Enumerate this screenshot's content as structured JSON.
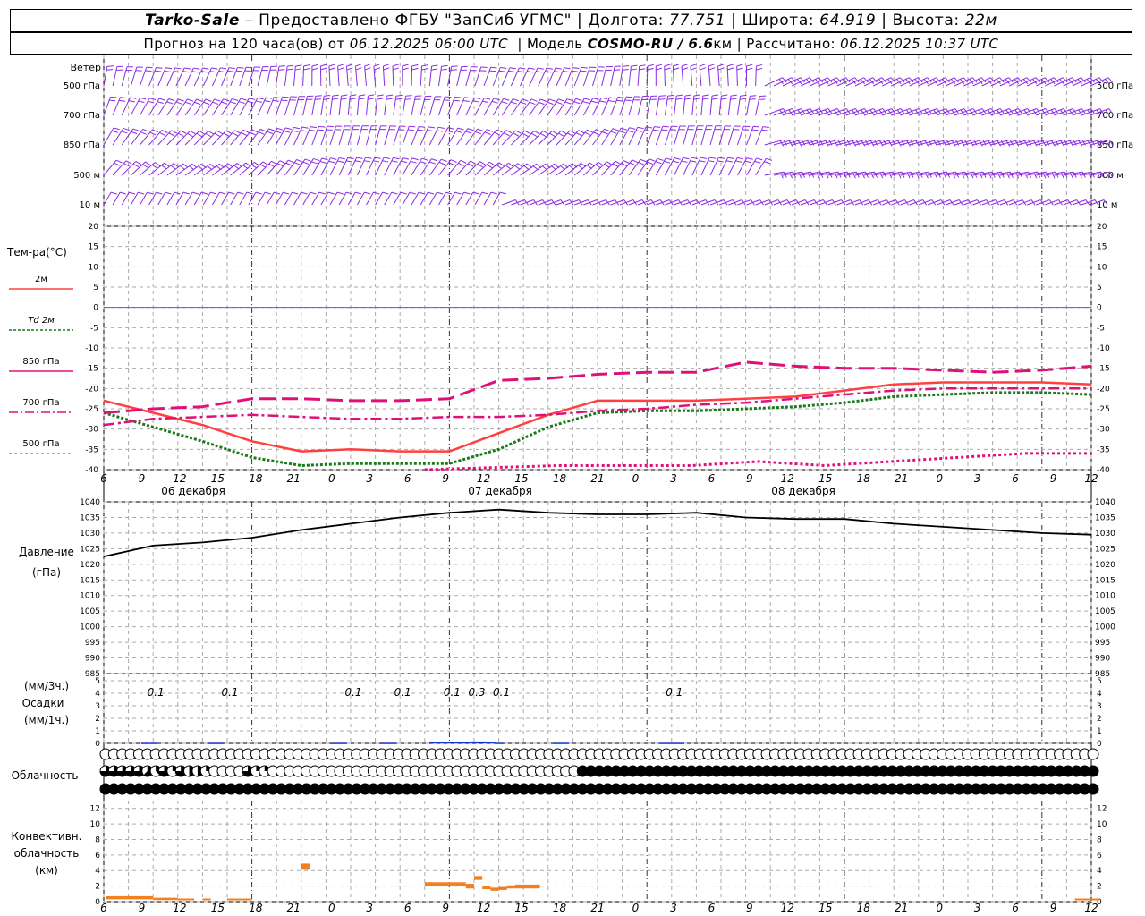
{
  "header": {
    "station": "Tarko-Sale",
    "dash": " – Предоставлено ФГБУ \"ЗапСиб УГМС\" | Долгота: ",
    "longitude": "77.751",
    "lat_label": " | Широта: ",
    "latitude": "64.919",
    "alt_label": " | Высота: ",
    "altitude": "22м",
    "forecast_label": "Прогноз на 120 часа(ов) от ",
    "forecast_start": "06.12.2025 06:00 UTC",
    "model_label": "  | Модель ",
    "model": "COSMO-RU / 6.6",
    "model_unit": "км",
    "calc_label": " | Рассчитано: ",
    "calc_time": "06.12.2025 10:37 UTC"
  },
  "labels": {
    "wind": "Ветер",
    "levels": [
      "500 гПа",
      "700 гПа",
      "850 гПа",
      "500 м",
      "10  м"
    ],
    "temp_title": "Тем-ра(°C)",
    "legend": [
      {
        "text": "2м",
        "color": "#ff4040",
        "dash": ""
      },
      {
        "text": "Td  2м",
        "color": "#1a7a1a",
        "dash": "3,2"
      },
      {
        "text": "850 гПа",
        "color": "#e0107a",
        "dash": ""
      },
      {
        "text": "700 гПа",
        "color": "#e0107a",
        "dash": "10,3,2,3"
      },
      {
        "text": "500 гПа",
        "color": "#e0107a",
        "dash": "3,3"
      }
    ],
    "pressure_title": "Давление",
    "pressure_unit": "(гПа)",
    "precip_unit1": "(мм/3ч.)",
    "precip_title": "Осадки",
    "precip_unit2": "(мм/1ч.)",
    "cloud_title": "Облачность",
    "conv_title1": "Конвективн.",
    "conv_title2": "облачность",
    "conv_unit": "(км)",
    "dates": [
      "06 декабря",
      "07 декабря",
      "08 декабря"
    ]
  },
  "colors": {
    "wind": "#8a2be2",
    "t2m": "#ff4040",
    "td2m": "#1a7a1a",
    "t850": "#e0107a",
    "zero": "#4060ff",
    "precip": "#1030d0",
    "conv": "#f08020"
  },
  "chart_data": [
    {
      "type": "line",
      "title": "Тем-ра(°C)",
      "x_ticks": [
        "6",
        "9",
        "12",
        "15",
        "18",
        "21",
        "0",
        "3",
        "6",
        "9",
        "12",
        "15",
        "18",
        "21",
        "0",
        "3",
        "6",
        "9",
        "12",
        "15",
        "18",
        "21",
        "0",
        "3",
        "6",
        "9",
        "12"
      ],
      "ylim": [
        -40,
        20
      ],
      "yticks": [
        -40,
        -35,
        -30,
        -25,
        -20,
        -15,
        -10,
        -5,
        0,
        5,
        10,
        15,
        20
      ],
      "x_hours": [
        0,
        6,
        12,
        18,
        24,
        30,
        36,
        42,
        48,
        54,
        60,
        66,
        72,
        78,
        84,
        90,
        96,
        102,
        108,
        114,
        120
      ],
      "series": [
        {
          "name": "2м",
          "values": [
            -23,
            -26,
            -29,
            -33,
            -35.5,
            -35,
            -35.5,
            -35.5,
            -31,
            -26.5,
            -23,
            -23,
            -23,
            -22.5,
            -22,
            -20.5,
            -19,
            -18.5,
            -18.5,
            -18.5,
            -19
          ]
        },
        {
          "name": "Td  2м",
          "values": [
            -26,
            -29.5,
            -33,
            -37,
            -39,
            -38.5,
            -38.5,
            -38.5,
            -35,
            -29.5,
            -26,
            -25.5,
            -25.5,
            -25,
            -24.5,
            -23.5,
            -22,
            -21.5,
            -21,
            -21,
            -21.5
          ]
        },
        {
          "name": "850 гПа",
          "values": [
            -26,
            -25,
            -24.5,
            -22.5,
            -22.5,
            -23,
            -23,
            -22.5,
            -18,
            -17.5,
            -16.5,
            -16,
            -16,
            -13.5,
            -14.5,
            -15,
            -15,
            -15.5,
            -16,
            -15.5,
            -14.5
          ]
        },
        {
          "name": "700 гПа",
          "values": [
            -29,
            -27.5,
            -27,
            -26.5,
            -27,
            -27.5,
            -27.5,
            -27,
            -27,
            -26.5,
            -25.5,
            -25,
            -24,
            -23.5,
            -22.5,
            -21.5,
            -20.5,
            -20,
            -20,
            -20,
            -20
          ]
        },
        {
          "name": "500 гПа",
          "x_start": 39,
          "values": [
            -40,
            -39.5,
            -39,
            -39,
            -39,
            -38,
            -39,
            -38,
            -37,
            -36,
            -36
          ]
        }
      ]
    },
    {
      "type": "line",
      "title": "Давление",
      "ylim": [
        985,
        1040
      ],
      "yticks": [
        985,
        990,
        995,
        1000,
        1005,
        1010,
        1015,
        1020,
        1025,
        1030,
        1035,
        1040
      ],
      "x_hours": [
        0,
        6,
        12,
        18,
        24,
        30,
        36,
        42,
        48,
        54,
        60,
        66,
        72,
        78,
        84,
        90,
        96,
        102,
        108,
        114,
        120
      ],
      "series": [
        {
          "name": "Давление",
          "values": [
            1022.5,
            1026,
            1027,
            1028.5,
            1031,
            1033,
            1035,
            1036.5,
            1037.5,
            1036.5,
            1036,
            1036,
            1036.5,
            1035,
            1034.5,
            1034.5,
            1033,
            1032,
            1031,
            1030,
            1029.5
          ]
        }
      ]
    },
    {
      "type": "bar",
      "title": "Осадки",
      "ylim": [
        0,
        5
      ],
      "yticks": [
        0,
        1,
        2,
        3,
        4,
        5
      ],
      "labels_3h": [
        {
          "hour": 6,
          "text": "0.1"
        },
        {
          "hour": 15,
          "text": "0.1"
        },
        {
          "hour": 30,
          "text": "0.1"
        },
        {
          "hour": 36,
          "text": "0.1"
        },
        {
          "hour": 42,
          "text": "0.1"
        },
        {
          "hour": 45,
          "text": "0.3"
        },
        {
          "hour": 48,
          "text": "0.1"
        },
        {
          "hour": 69,
          "text": "0.1"
        }
      ],
      "bars": [
        {
          "hour": 5,
          "value": 0.05
        },
        {
          "hour": 6,
          "value": 0.05
        },
        {
          "hour": 13,
          "value": 0.05
        },
        {
          "hour": 14,
          "value": 0.05
        },
        {
          "hour": 28,
          "value": 0.05
        },
        {
          "hour": 29,
          "value": 0.05
        },
        {
          "hour": 34,
          "value": 0.05
        },
        {
          "hour": 35,
          "value": 0.05
        },
        {
          "hour": 40,
          "value": 0.1
        },
        {
          "hour": 41,
          "value": 0.1
        },
        {
          "hour": 42,
          "value": 0.1
        },
        {
          "hour": 43,
          "value": 0.1
        },
        {
          "hour": 44,
          "value": 0.1
        },
        {
          "hour": 45,
          "value": 0.15
        },
        {
          "hour": 46,
          "value": 0.15
        },
        {
          "hour": 47,
          "value": 0.1
        },
        {
          "hour": 48,
          "value": 0.05
        },
        {
          "hour": 55,
          "value": 0.05
        },
        {
          "hour": 56,
          "value": 0.05
        },
        {
          "hour": 68,
          "value": 0.05
        },
        {
          "hour": 69,
          "value": 0.05
        },
        {
          "hour": 70,
          "value": 0.05
        }
      ]
    },
    {
      "type": "heatmap",
      "title": "Облачность",
      "note": "cloud cover octas 0-8 per 1h step, 3 rows (upper, middle, lower)",
      "rows": [
        "000000000000000000000000000000000000000000000000000000000000000000000000000000000000000000000000000000000000000000000000000",
        "666665362644200006220000000000000000000000000000000000000888888888888888888888888888888888888888888888888888888888888888888",
        "888888888888888888888888888888888888888888888888888888888888888888888888888888888888888888888888888888888888888888888888888"
      ]
    },
    {
      "type": "bar",
      "title": "Конвективн. облачность",
      "ylim": [
        0,
        13
      ],
      "yticks": [
        0,
        2,
        4,
        6,
        8,
        10,
        12
      ],
      "segments": [
        {
          "from": 0.3,
          "to": 6,
          "base": 0.3,
          "top": 0.7
        },
        {
          "from": 6,
          "to": 9,
          "base": 0.2,
          "top": 0.5
        },
        {
          "from": 9,
          "to": 11,
          "base": 0.2,
          "top": 0.4
        },
        {
          "from": 12,
          "to": 13,
          "base": 0.2,
          "top": 0.4
        },
        {
          "from": 15,
          "to": 18,
          "base": 0.2,
          "top": 0.4
        },
        {
          "from": 24,
          "to": 25,
          "base": 4.1,
          "top": 4.9
        },
        {
          "from": 39,
          "to": 44,
          "base": 2.0,
          "top": 2.5
        },
        {
          "from": 44,
          "to": 45,
          "base": 1.7,
          "top": 2.3
        },
        {
          "from": 45,
          "to": 46,
          "base": 2.8,
          "top": 3.3
        },
        {
          "from": 46,
          "to": 47,
          "base": 1.6,
          "top": 2.0
        },
        {
          "from": 47,
          "to": 48,
          "base": 1.4,
          "top": 1.8
        },
        {
          "from": 48,
          "to": 49,
          "base": 1.5,
          "top": 1.9
        },
        {
          "from": 49,
          "to": 50,
          "base": 1.7,
          "top": 2.1
        },
        {
          "from": 50,
          "to": 53,
          "base": 1.7,
          "top": 2.2
        },
        {
          "from": 118,
          "to": 121,
          "base": 0.2,
          "top": 0.4
        }
      ]
    }
  ]
}
